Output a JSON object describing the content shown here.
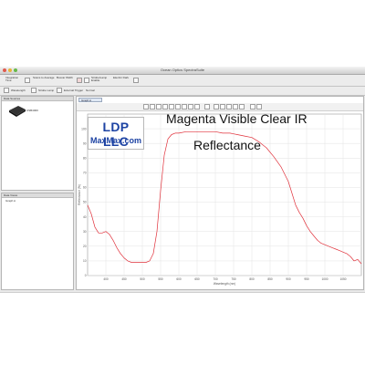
{
  "window": {
    "title": "Ocean Optics SpectraSuite"
  },
  "toolbar": {
    "items": [
      "Integration Time",
      "Scans to Average",
      "Boxcar Width",
      "Strobe/Lamp Enable",
      "Electric Dark"
    ],
    "row2_items": [
      "Wavelength",
      "Strobe Lamp",
      "External Trigger",
      "Normal"
    ]
  },
  "left_panel_top": {
    "header": "Data Sources",
    "device_label": "USB4000"
  },
  "left_panel_bottom": {
    "header": "Data Views",
    "item": "Graph A"
  },
  "main_tab": {
    "label": "Graph A"
  },
  "logo": {
    "line1": "LDP LLC",
    "line2": "MaxMax.com"
  },
  "chart_data": {
    "type": "line",
    "title": "Magenta Visible Clear IR",
    "subtitle": "Reflectance",
    "xlabel": "Wavelength (nm)",
    "ylabel": "Reflectance (%)",
    "xlim": [
      350,
      1100
    ],
    "ylim": [
      0,
      110
    ],
    "x_ticks": [
      400,
      450,
      500,
      550,
      600,
      650,
      700,
      750,
      800,
      850,
      900,
      950,
      1000,
      1050
    ],
    "y_ticks": [
      0,
      10,
      20,
      30,
      40,
      50,
      60,
      70,
      80,
      90,
      100
    ],
    "grid": true,
    "series": [
      {
        "color": "#e0303a",
        "x": [
          350,
          360,
          370,
          380,
          390,
          400,
          410,
          420,
          430,
          440,
          450,
          460,
          470,
          480,
          490,
          500,
          510,
          520,
          530,
          540,
          550,
          560,
          570,
          580,
          590,
          600,
          620,
          640,
          660,
          680,
          700,
          720,
          740,
          760,
          780,
          800,
          820,
          840,
          860,
          880,
          900,
          910,
          920,
          930,
          940,
          950,
          960,
          970,
          980,
          990,
          1000,
          1010,
          1020,
          1030,
          1040,
          1050,
          1060,
          1070,
          1080,
          1090,
          1100
        ],
        "y": [
          48,
          42,
          33,
          29,
          29,
          30,
          28,
          24,
          19,
          15,
          12,
          10,
          9,
          9,
          9,
          9,
          9,
          10,
          15,
          30,
          58,
          82,
          93,
          96,
          97,
          97,
          98,
          98,
          98,
          98,
          98,
          97,
          97,
          96,
          95,
          94,
          91,
          87,
          81,
          74,
          64,
          56,
          48,
          43,
          39,
          34,
          30,
          27,
          24,
          22,
          21,
          20,
          19,
          18,
          17,
          16,
          15,
          13,
          10,
          11,
          8
        ]
      }
    ]
  }
}
